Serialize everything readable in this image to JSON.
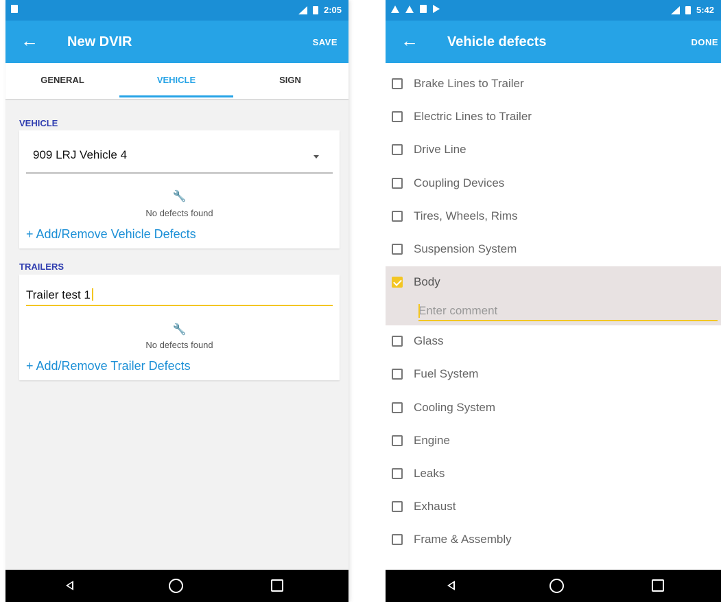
{
  "left": {
    "status": {
      "time": "2:05"
    },
    "app_bar": {
      "title": "New DVIR",
      "action": "SAVE"
    },
    "tabs": [
      {
        "label": "GENERAL"
      },
      {
        "label": "VEHICLE"
      },
      {
        "label": "SIGN"
      }
    ],
    "vehicle": {
      "section_label": "VEHICLE",
      "selected": "909 LRJ Vehicle 4",
      "no_defects": "No defects found",
      "add_link": "+ Add/Remove Vehicle Defects"
    },
    "trailers": {
      "section_label": "TRAILERS",
      "value": "Trailer test 1",
      "no_defects": "No defects found",
      "add_link": "+ Add/Remove Trailer Defects"
    },
    "icons": {
      "back": "arrow-left-icon",
      "wrench": "wrench-icon"
    }
  },
  "right": {
    "status": {
      "time": "5:42"
    },
    "app_bar": {
      "title": "Vehicle defects",
      "action": "DONE"
    },
    "defects": [
      {
        "label": "Brake Lines to Trailer",
        "checked": false
      },
      {
        "label": "Electric Lines to Trailer",
        "checked": false
      },
      {
        "label": "Drive Line",
        "checked": false
      },
      {
        "label": "Coupling Devices",
        "checked": false
      },
      {
        "label": "Tires, Wheels, Rims",
        "checked": false
      },
      {
        "label": "Suspension System",
        "checked": false
      },
      {
        "label": "Body",
        "checked": true
      },
      {
        "label": "Glass",
        "checked": false
      },
      {
        "label": "Fuel System",
        "checked": false
      },
      {
        "label": "Cooling System",
        "checked": false
      },
      {
        "label": "Engine",
        "checked": false
      },
      {
        "label": "Leaks",
        "checked": false
      },
      {
        "label": "Exhaust",
        "checked": false
      },
      {
        "label": "Frame & Assembly",
        "checked": false
      }
    ],
    "comment": {
      "placeholder": "Enter comment",
      "value": ""
    }
  },
  "colors": {
    "status_bar": "#1b8fd6",
    "app_bar": "#26a3e6",
    "accent_yellow": "#f3c623",
    "section_label": "#2f3db0",
    "selected_row": "#e8e2e2"
  }
}
